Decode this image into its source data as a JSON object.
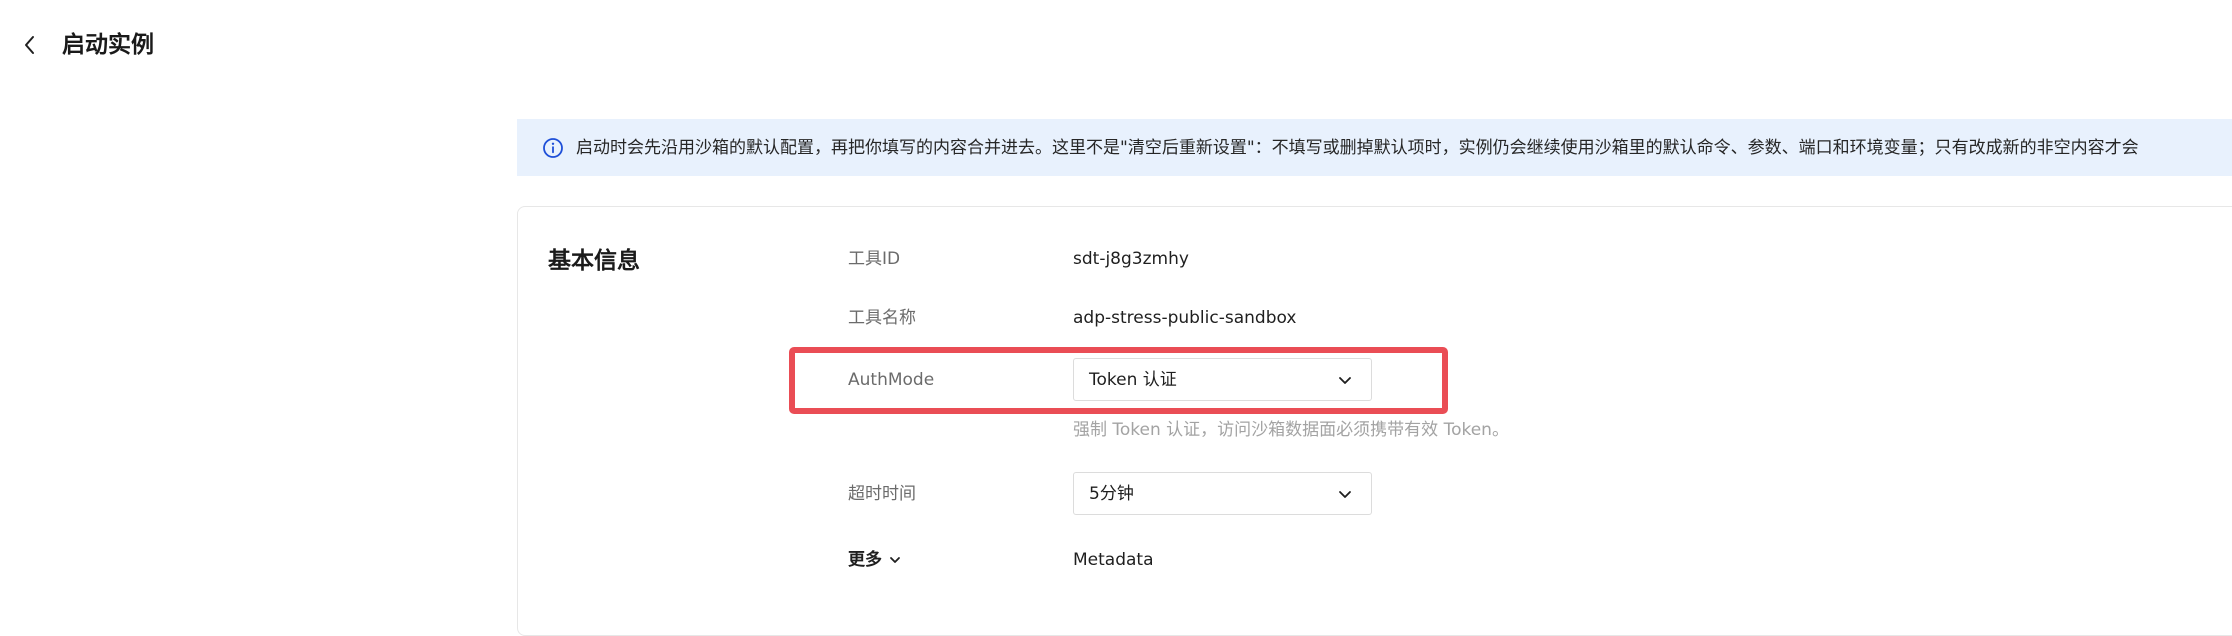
{
  "header": {
    "title": "启动实例"
  },
  "notice": {
    "text": "启动时会先沿用沙箱的默认配置，再把你填写的内容合并进去。这里不是\"清空后重新设置\"：不填写或删掉默认项时，实例仍会继续使用沙箱里的默认命令、参数、端口和环境变量；只有改成新的非空内容才会"
  },
  "basic_info": {
    "section_title": "基本信息",
    "tool_id": {
      "label": "工具ID",
      "value": "sdt-j8g3zmhy"
    },
    "tool_name": {
      "label": "工具名称",
      "value": "adp-stress-public-sandbox"
    },
    "auth_mode": {
      "label": "AuthMode",
      "selected": "Token 认证",
      "hint": "强制 Token 认证，访问沙箱数据面必须携带有效 Token。"
    },
    "timeout": {
      "label": "超时时间",
      "selected": "5分钟"
    },
    "more": {
      "label": "更多",
      "value": "Metadata"
    }
  },
  "colors": {
    "notice_bg": "#e8f1fd",
    "info_icon": "#1e4fd8",
    "highlight_border": "#ea4d55",
    "label_text": "#6b6b6b",
    "hint_text": "#a3a3a3"
  },
  "icons": {
    "back": "chevron-left-icon",
    "info": "info-circle-icon",
    "dropdown": "chevron-down-icon"
  }
}
